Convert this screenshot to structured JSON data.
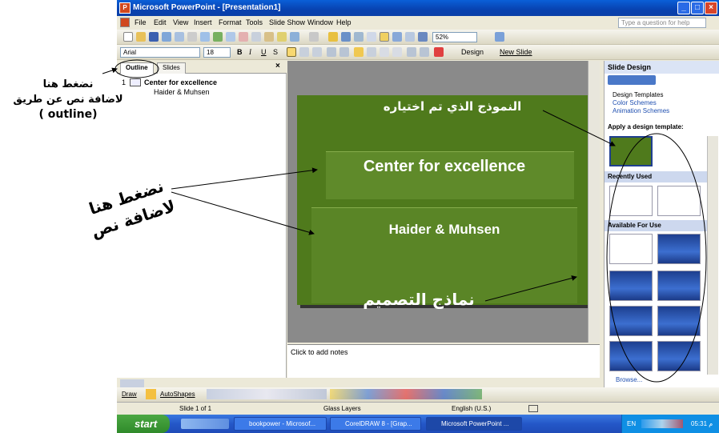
{
  "window": {
    "title": "Microsoft PowerPoint - [Presentation1]"
  },
  "menu": {
    "items": [
      "File",
      "Edit",
      "View",
      "Insert",
      "Format",
      "Tools",
      "Slide Show",
      "Window",
      "Help"
    ],
    "help_placeholder": "Type a question for help"
  },
  "toolbar": {
    "zoom": "52%",
    "font_name": "Arial",
    "font_size": "18",
    "bold": "B",
    "italic": "I",
    "underline": "U",
    "shadow": "S",
    "design_label": "Design",
    "new_slide_label": "New Slide"
  },
  "left_pane": {
    "tabs": [
      "Outline",
      "Slides"
    ],
    "slide_number": "1",
    "slide_title": "Center for excellence",
    "slide_subtitle": "Haider & Muhsen"
  },
  "slide": {
    "title": "Center for excellence",
    "subtitle": "Haider & Muhsen"
  },
  "notes": {
    "placeholder": "Click to add notes"
  },
  "task_pane": {
    "title": "Slide Design",
    "links": [
      "Design Templates",
      "Color Schemes",
      "Animation Schemes"
    ],
    "apply_label": "Apply a design template:",
    "recently_used": "Recently Used",
    "available": "Available For Use",
    "browse": "Browse..."
  },
  "draw_bar": {
    "draw_label": "Draw",
    "autoshapes_label": "AutoShapes"
  },
  "status": {
    "slide": "Slide 1 of 1",
    "design": "Glass Layers",
    "language": "English (U.S.)"
  },
  "taskbar": {
    "start": "start",
    "items": [
      "bookpower - Microsof...",
      "CorelDRAW 8 - [Grap...",
      "Microsoft PowerPoint ..."
    ],
    "lang": "EN",
    "time": "05:31 م"
  },
  "annotations": {
    "outline_hint": [
      "نضغط هنا",
      "لاضافة نص عن طريق",
      "(outline )"
    ],
    "add_text_hint": [
      "نضغط هنا",
      "لاضافة نص"
    ],
    "selected_template": "النموذج الذي تم اختياره",
    "design_templates": "نماذج التصميم"
  },
  "colors": {
    "slide_green": "#4f7a1c",
    "xp_blue": "#0a5fd8",
    "task_section": "#cdd8ee"
  }
}
